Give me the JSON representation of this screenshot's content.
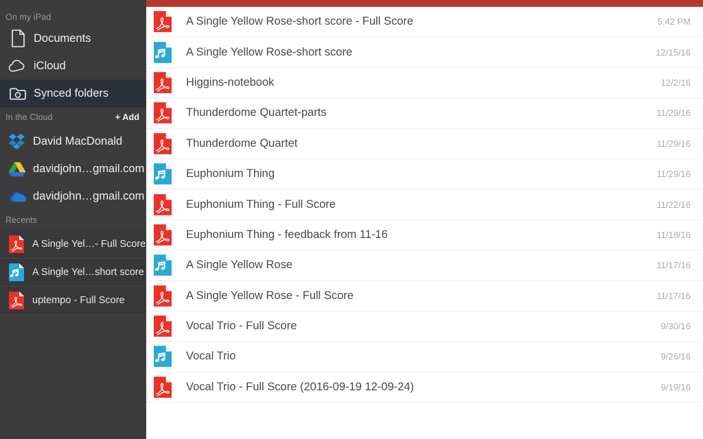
{
  "sidebar": {
    "local_section": {
      "header": "On my iPad",
      "items": [
        {
          "label": "Documents",
          "icon": "document-icon",
          "selected": false
        },
        {
          "label": "iCloud",
          "icon": "cloud-icon",
          "selected": false
        },
        {
          "label": "Synced folders",
          "icon": "synced-folder-icon",
          "selected": true
        }
      ]
    },
    "cloud_section": {
      "header": "In the Cloud",
      "add_label": "+ Add",
      "items": [
        {
          "label": "David MacDonald",
          "icon": "dropbox-icon"
        },
        {
          "label": "davidjohn…gmail.com",
          "icon": "google-drive-icon"
        },
        {
          "label": "davidjohn…gmail.com",
          "icon": "onedrive-icon"
        }
      ]
    },
    "recents_section": {
      "header": "Recents",
      "items": [
        {
          "label": "A Single Yel…- Full Score",
          "icon": "pdf-icon"
        },
        {
          "label": "A Single Yel…short score",
          "icon": "score-icon"
        },
        {
          "label": "uptempo - Full Score",
          "icon": "pdf-icon"
        }
      ]
    }
  },
  "colors": {
    "topbar_red": "#b5392f",
    "sidebar_bg": "#3c3c3c",
    "sidebar_selected": "#2b303b",
    "pdf_red": "#e8332a",
    "score_blue": "#2aa9d4",
    "file_text": "#44484b",
    "date_text": "#a9acae"
  },
  "main": {
    "files": [
      {
        "name": "A Single Yellow Rose-short score - Full Score",
        "date": "5:42 PM",
        "icon": "pdf-icon"
      },
      {
        "name": "A Single Yellow Rose-short score",
        "date": "12/15/16",
        "icon": "score-icon"
      },
      {
        "name": "Higgins-notebook",
        "date": "12/2/16",
        "icon": "pdf-icon"
      },
      {
        "name": "Thunderdome Quartet-parts",
        "date": "11/29/16",
        "icon": "pdf-icon"
      },
      {
        "name": "Thunderdome Quartet",
        "date": "11/29/16",
        "icon": "pdf-icon"
      },
      {
        "name": "Euphonium Thing",
        "date": "11/29/16",
        "icon": "score-icon"
      },
      {
        "name": "Euphonium Thing - Full Score",
        "date": "11/22/16",
        "icon": "pdf-icon"
      },
      {
        "name": "Euphonium Thing - feedback from 11-16",
        "date": "11/18/16",
        "icon": "pdf-icon"
      },
      {
        "name": "A Single Yellow Rose",
        "date": "11/17/16",
        "icon": "score-icon"
      },
      {
        "name": "A Single Yellow Rose - Full Score",
        "date": "11/17/16",
        "icon": "pdf-icon"
      },
      {
        "name": "Vocal Trio - Full Score",
        "date": "9/30/16",
        "icon": "pdf-icon"
      },
      {
        "name": "Vocal Trio",
        "date": "9/26/16",
        "icon": "score-icon"
      },
      {
        "name": "Vocal Trio - Full Score (2016-09-19 12-09-24)",
        "date": "9/19/16",
        "icon": "pdf-icon"
      }
    ]
  }
}
